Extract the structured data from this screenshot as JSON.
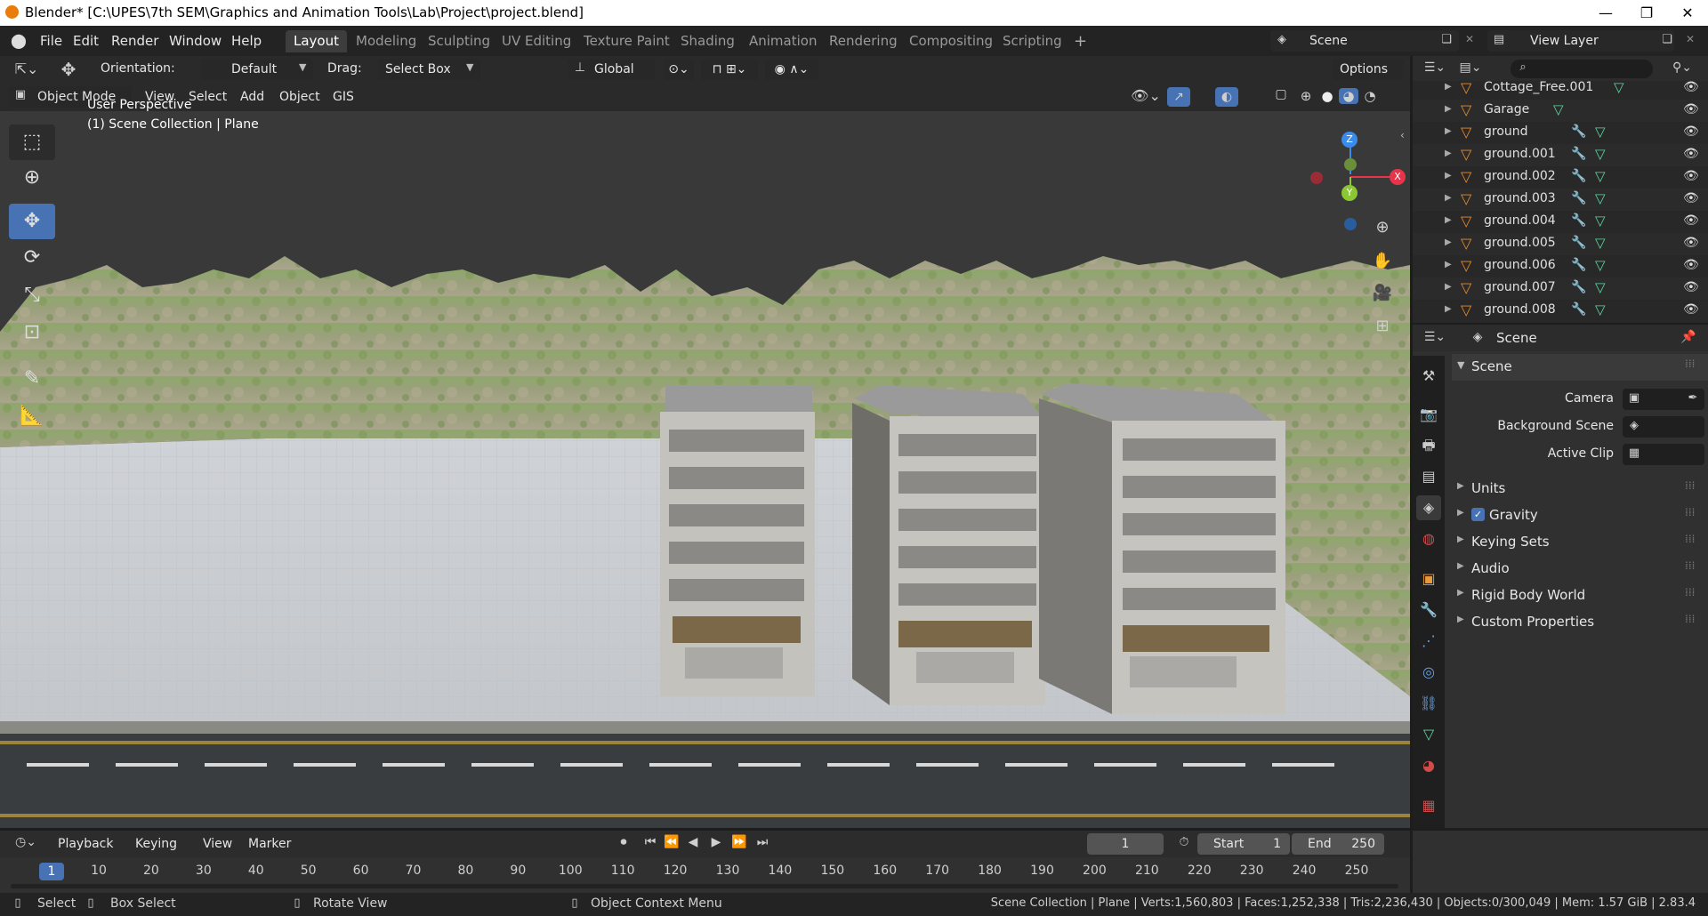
{
  "titlebar": {
    "title": "Blender* [C:\\UPES\\7th SEM\\Graphics and Animation Tools\\Lab\\Project\\project.blend]",
    "min": "—",
    "max": "❐",
    "close": "✕"
  },
  "menu": [
    "File",
    "Edit",
    "Render",
    "Window",
    "Help"
  ],
  "workspaces": [
    "Layout",
    "Modeling",
    "Sculpting",
    "UV Editing",
    "Texture Paint",
    "Shading",
    "Animation",
    "Rendering",
    "Compositing",
    "Scripting"
  ],
  "scene_field": "Scene",
  "view_layer_field": "View Layer",
  "tool_header": {
    "orientation_label": "Orientation:",
    "orientation_value": "Default",
    "drag_label": "Drag:",
    "drag_value": "Select Box",
    "transform_value": "Global",
    "options_label": "Options"
  },
  "vp_header": {
    "mode": "Object Mode",
    "menus": [
      "View",
      "Select",
      "Add",
      "Object",
      "GIS"
    ]
  },
  "viewport": {
    "perspective": "User Perspective",
    "collection": "(1) Scene Collection | Plane"
  },
  "gizmo": {
    "x": "X",
    "y": "Y",
    "z": "Z"
  },
  "outliner": {
    "items": [
      {
        "name": "Cottage_Free.001",
        "mod": false
      },
      {
        "name": "Garage",
        "mod": false
      },
      {
        "name": "ground",
        "mod": true
      },
      {
        "name": "ground.001",
        "mod": true
      },
      {
        "name": "ground.002",
        "mod": true
      },
      {
        "name": "ground.003",
        "mod": true
      },
      {
        "name": "ground.004",
        "mod": true
      },
      {
        "name": "ground.005",
        "mod": true
      },
      {
        "name": "ground.006",
        "mod": true
      },
      {
        "name": "ground.007",
        "mod": true
      },
      {
        "name": "ground.008",
        "mod": true
      }
    ]
  },
  "properties": {
    "header": "Scene",
    "panel_title": "Scene",
    "camera_label": "Camera",
    "bg_scene_label": "Background Scene",
    "active_clip_label": "Active Clip",
    "sections": [
      "Units",
      "Gravity",
      "Keying Sets",
      "Audio",
      "Rigid Body World",
      "Custom Properties"
    ],
    "gravity_checked": true
  },
  "timeline": {
    "menus": [
      "Playback",
      "Keying",
      "View",
      "Marker"
    ],
    "current_frame": "1",
    "start_label": "Start",
    "start_value": "1",
    "end_label": "End",
    "end_value": "250",
    "ticks": [
      "1",
      "10",
      "20",
      "30",
      "40",
      "50",
      "60",
      "70",
      "80",
      "90",
      "100",
      "110",
      "120",
      "130",
      "140",
      "150",
      "160",
      "170",
      "180",
      "190",
      "200",
      "210",
      "220",
      "230",
      "240",
      "250"
    ]
  },
  "statusbar": {
    "select": "Select",
    "box_select": "Box Select",
    "rotate": "Rotate View",
    "context": "Object Context Menu",
    "stats": "Scene Collection | Plane | Verts:1,560,803 | Faces:1,252,338 | Tris:2,236,430 | Objects:0/300,049 | Mem: 1.57 GiB | 2.83.4"
  },
  "colors": {
    "accent": "#4772b3",
    "orange": "#e87d0d",
    "mesh_green": "#5bd6a0",
    "x_axis": "#e8344a",
    "y_axis": "#8ac733",
    "z_axis": "#3b8bea"
  }
}
